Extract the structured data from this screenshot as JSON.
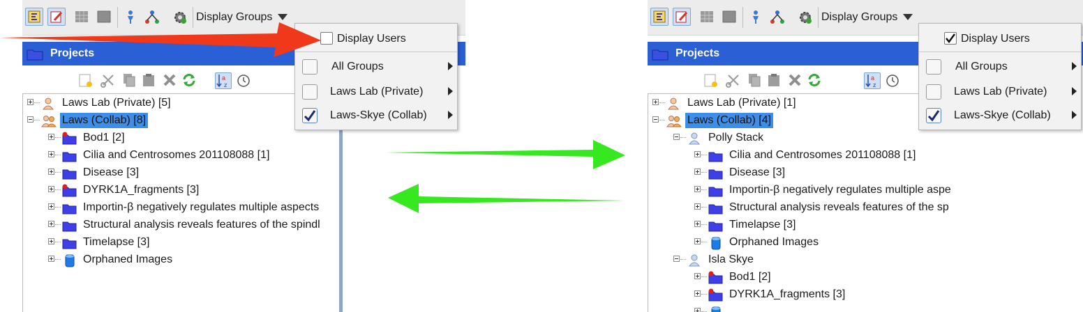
{
  "left_panel": {
    "toolbar": {
      "display_groups_label": "Display Groups"
    },
    "projects_title": "Projects",
    "tree": [
      {
        "label": "Laws Lab (Private) [5]",
        "icon": "user-icon",
        "level": 0,
        "expander": "plus",
        "highlight": false
      },
      {
        "label": "Laws (Collab) [8]",
        "icon": "group-icon",
        "level": 0,
        "expander": "minus",
        "highlight": true
      },
      {
        "label": "Bod1 [2]",
        "icon": "shared-folder-icon",
        "level": 1,
        "expander": "plus",
        "highlight": false
      },
      {
        "label": "Cilia and Centrosomes 201108088 [1]",
        "icon": "folder-icon",
        "level": 1,
        "expander": "plus",
        "highlight": false
      },
      {
        "label": "Disease [3]",
        "icon": "folder-icon",
        "level": 1,
        "expander": "plus",
        "highlight": false
      },
      {
        "label": "DYRK1A_fragments [3]",
        "icon": "shared-folder-icon",
        "level": 1,
        "expander": "plus",
        "highlight": false
      },
      {
        "label": "Importin-β negatively regulates multiple aspects",
        "icon": "folder-icon",
        "level": 1,
        "expander": "plus",
        "highlight": false
      },
      {
        "label": "Structural analysis reveals features of the spindl",
        "icon": "folder-icon",
        "level": 1,
        "expander": "plus",
        "highlight": false
      },
      {
        "label": "Timelapse [3]",
        "icon": "folder-icon",
        "level": 1,
        "expander": "plus",
        "highlight": false
      },
      {
        "label": "Orphaned Images",
        "icon": "orphan-images-icon",
        "level": 1,
        "expander": "plus",
        "highlight": false
      }
    ],
    "menu": {
      "display_users": {
        "label": "Display Users",
        "checked": false
      },
      "items": [
        {
          "label": "All Groups",
          "checked": false
        },
        {
          "label": "Laws Lab (Private)",
          "checked": false
        },
        {
          "label": "Laws-Skye (Collab)",
          "checked": true
        }
      ]
    }
  },
  "right_panel": {
    "toolbar": {
      "display_groups_label": "Display Groups"
    },
    "projects_title": "Projects",
    "tree": [
      {
        "label": "Laws Lab (Private) [1]",
        "icon": "user-icon",
        "level": 0,
        "expander": "plus",
        "highlight": false
      },
      {
        "label": "Laws (Collab) [4]",
        "icon": "group-icon",
        "level": 0,
        "expander": "minus",
        "highlight": true
      },
      {
        "label": "Polly Stack",
        "icon": "person-icon",
        "level": 1,
        "expander": "minus",
        "highlight": false
      },
      {
        "label": "Cilia and Centrosomes 201108088 [1]",
        "icon": "folder-icon",
        "level": 2,
        "expander": "plus",
        "highlight": false
      },
      {
        "label": "Disease [3]",
        "icon": "folder-icon",
        "level": 2,
        "expander": "plus",
        "highlight": false
      },
      {
        "label": "Importin-β negatively regulates multiple aspe",
        "icon": "folder-icon",
        "level": 2,
        "expander": "plus",
        "highlight": false
      },
      {
        "label": "Structural analysis reveals features of the sp",
        "icon": "folder-icon",
        "level": 2,
        "expander": "plus",
        "highlight": false
      },
      {
        "label": "Timelapse [3]",
        "icon": "folder-icon",
        "level": 2,
        "expander": "plus",
        "highlight": false
      },
      {
        "label": "Orphaned Images",
        "icon": "orphan-images-icon",
        "level": 2,
        "expander": "plus",
        "highlight": false
      },
      {
        "label": "Isla Skye",
        "icon": "person-icon",
        "level": 1,
        "expander": "minus",
        "highlight": false
      },
      {
        "label": "Bod1 [2]",
        "icon": "shared-folder-icon",
        "level": 2,
        "expander": "plus",
        "highlight": false
      },
      {
        "label": "DYRK1A_fragments [3]",
        "icon": "shared-folder-icon",
        "level": 2,
        "expander": "plus",
        "highlight": false
      },
      {
        "label": "",
        "icon": "orphan-images-icon",
        "level": 2,
        "expander": "plus",
        "highlight": false
      }
    ],
    "menu": {
      "display_users": {
        "label": "Display Users",
        "checked": true
      },
      "items": [
        {
          "label": "All Groups",
          "checked": false
        },
        {
          "label": "Laws Lab (Private)",
          "checked": false
        },
        {
          "label": "Laws-Skye (Collab)",
          "checked": true
        }
      ]
    }
  },
  "colors": {
    "header_blue": "#2a5fd6",
    "highlight_blue": "#3d8ee8",
    "annotation_red": "#f0381a",
    "annotation_green": "#36e81f"
  }
}
